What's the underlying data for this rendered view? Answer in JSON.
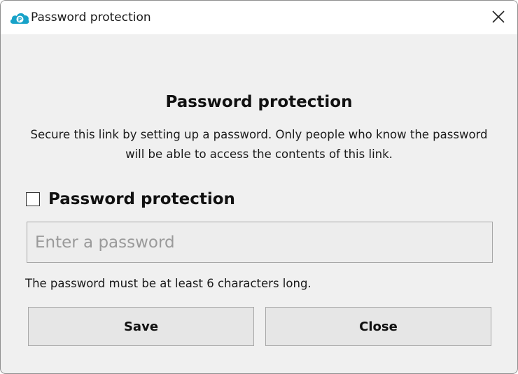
{
  "window": {
    "title": "Password protection",
    "app_icon": "pcloud-icon",
    "close_icon": "close-icon"
  },
  "dialog": {
    "heading": "Password protection",
    "description": "Secure this link by setting up a password. Only people who know the password will be able to access the contents of this link.",
    "checkbox": {
      "label": "Password protection",
      "checked": false
    },
    "password_input": {
      "placeholder": "Enter a password",
      "value": ""
    },
    "hint": "The password must be at least 6 characters long.",
    "buttons": {
      "save_label": "Save",
      "close_label": "Close"
    }
  },
  "colors": {
    "accent": "#17a2c8",
    "window_background": "#f0f0f0",
    "button_background": "#e6e6e6",
    "border": "#a8a8a8"
  }
}
